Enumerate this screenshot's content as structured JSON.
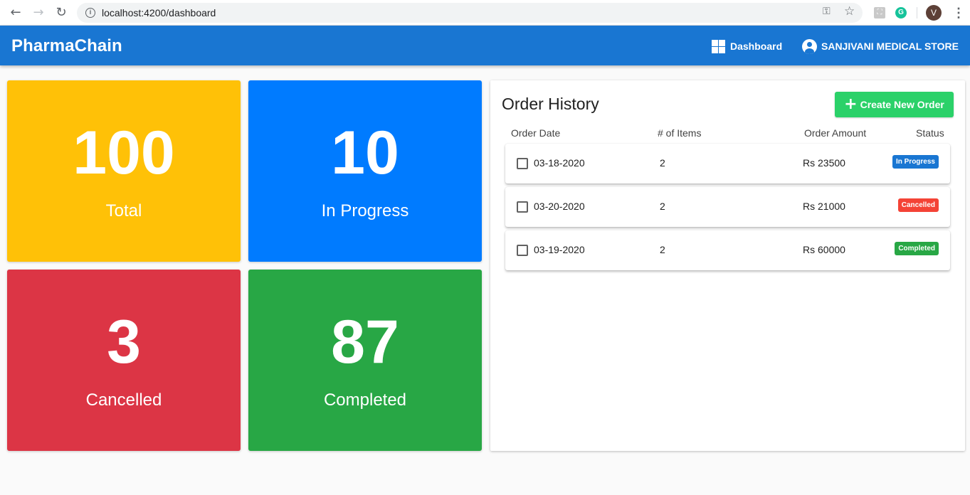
{
  "browser": {
    "url": "localhost:4200/dashboard",
    "avatar_initial": "V",
    "icons": [
      "back-icon",
      "forward-icon",
      "reload-icon",
      "info-icon",
      "key-icon",
      "star-icon",
      "extension-icon",
      "grammarly-icon",
      "menu-icon"
    ]
  },
  "appbar": {
    "brand": "PharmaChain",
    "dashboard_label": "Dashboard",
    "store_label": "SANJIVANI MEDICAL STORE",
    "color": "#1976d2"
  },
  "stats": [
    {
      "value": "100",
      "label": "Total",
      "color": "#ffc107"
    },
    {
      "value": "10",
      "label": "In Progress",
      "color": "#007bff"
    },
    {
      "value": "3",
      "label": "Cancelled",
      "color": "#dc3545"
    },
    {
      "value": "87",
      "label": "Completed",
      "color": "#28a745"
    }
  ],
  "orders": {
    "title": "Order History",
    "create_label": "Create New Order",
    "columns": [
      "Order Date",
      "# of Items",
      "Order Amount",
      "Status"
    ],
    "rows": [
      {
        "date": "03-18-2020",
        "items": "2",
        "amount": "Rs 23500",
        "status": "In Progress",
        "status_color": "#1976d2"
      },
      {
        "date": "03-20-2020",
        "items": "2",
        "amount": "Rs 21000",
        "status": "Cancelled",
        "status_color": "#f44336"
      },
      {
        "date": "03-19-2020",
        "items": "2",
        "amount": "Rs 60000",
        "status": "Completed",
        "status_color": "#28a745"
      }
    ]
  }
}
